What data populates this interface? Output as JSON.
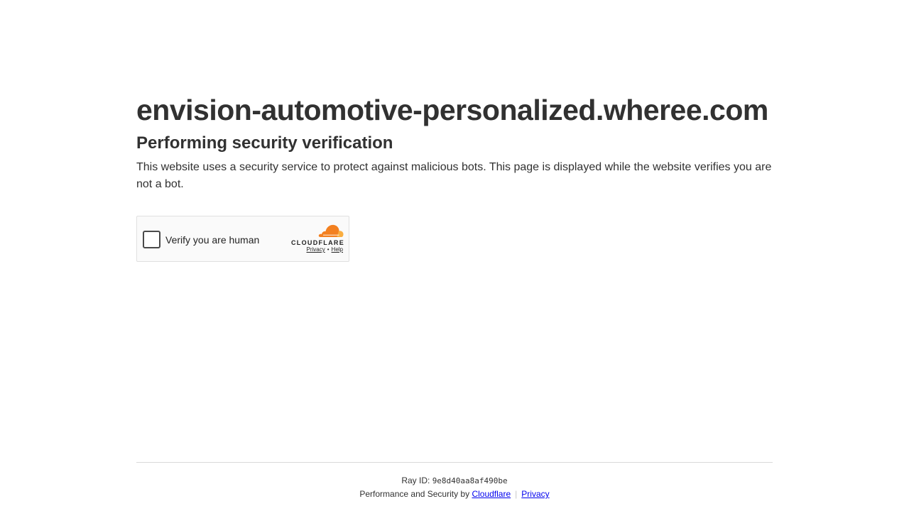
{
  "header": {
    "domain": "envision-automotive-personalized.wheree.com",
    "subtitle": "Performing security verification",
    "description": "This website uses a security service to protect against malicious bots. This page is displayed while the website verifies you are not a bot."
  },
  "widget": {
    "checkbox_label": "Verify you are human",
    "brand": "CLOUDFLARE",
    "privacy_link": "Privacy",
    "link_separator": "•",
    "help_link": "Help"
  },
  "footer": {
    "ray_label": "Ray ID:",
    "ray_id": "9e8d40aa8af490be",
    "perf_text": "Performance and Security by",
    "cloudflare_link": "Cloudflare",
    "separator": "|",
    "privacy_link": "Privacy"
  },
  "colors": {
    "text": "#313131",
    "cloudflare_orange": "#f38020",
    "cloudflare_light_orange": "#faae40",
    "link": "#0000ee"
  },
  "icons": {
    "logo": "cloudflare-cloud-icon"
  }
}
